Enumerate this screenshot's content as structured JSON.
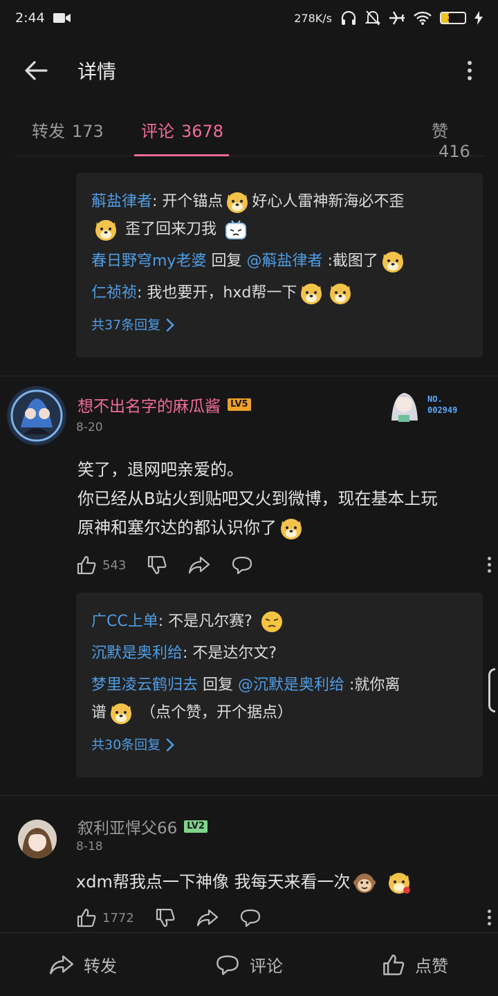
{
  "status": {
    "time": "2:44",
    "net_speed": "278K/s",
    "battery": "31"
  },
  "header": {
    "title": "详情"
  },
  "tabs": [
    {
      "label": "转发",
      "count": "173"
    },
    {
      "label": "评论",
      "count": "3678"
    },
    {
      "label": "赞",
      "count": "416"
    }
  ],
  "reply_block_1": {
    "r1_user": "蔛盐律者",
    "r1_text_a": ": 开个锚点",
    "r1_text_b": "好心人雷神新海必不歪",
    "r1_text_c": "歪了回来刀我",
    "r2_user": "春日野穹my老婆",
    "r2_reply": " 回复 ",
    "r2_mention": "@蔛盐律者",
    "r2_text": " :截图了",
    "r3_user": "仁祯祯",
    "r3_text": ": 我也要开，hxd帮一下",
    "more": "共37条回复"
  },
  "comment_1": {
    "username": "想不出名字的麻瓜酱",
    "level": "LV5",
    "date": "8-20",
    "badge_label": "NO.",
    "badge_number": "002949",
    "text_l1": "笑了，退网吧亲爱的。",
    "text_l2": "你已经从B站火到贴吧又火到微博，现在基本上玩",
    "text_l3": "原神和塞尔达的都认识你了",
    "likes": "543"
  },
  "reply_block_2": {
    "r1_user": "广CC上单",
    "r1_text": ": 不是凡尔赛?",
    "r2_user": "沉默是奥利给",
    "r2_text": ": 不是达尔文?",
    "r3_user": "梦里凌云鹤归去",
    "r3_reply": " 回复 ",
    "r3_mention": "@沉默是奥利给",
    "r3_text_a": " :就你离",
    "r3_text_b": "谱",
    "r3_text_c": "（点个赞，开个据点）",
    "more": "共30条回复"
  },
  "comment_2": {
    "username": "叙利亚悍父66",
    "level": "LV2",
    "date": "8-18",
    "text": "xdm帮我点一下神像 我每天来看一次",
    "likes": "1772"
  },
  "bottombar": {
    "forward": "转发",
    "comment": "评论",
    "like": "点赞"
  },
  "colors": {
    "accent_pink": "#f06d96",
    "link_blue": "#4f9de6",
    "lv5": "#f1a12a",
    "lv2": "#7ed48a"
  }
}
